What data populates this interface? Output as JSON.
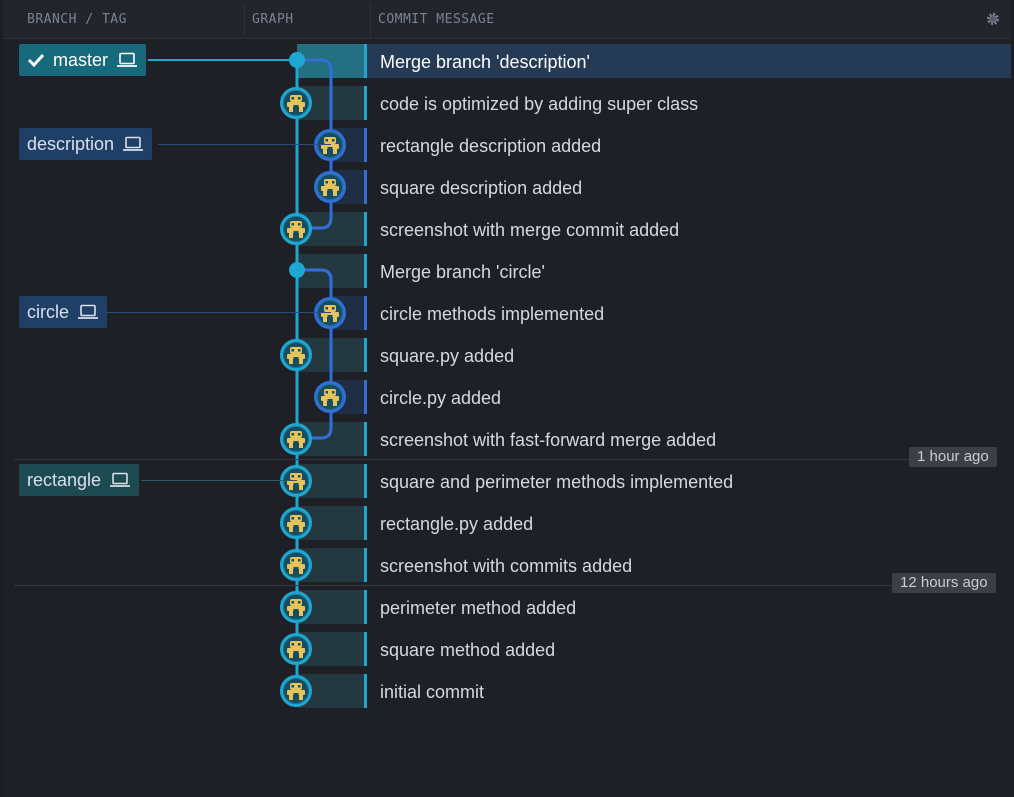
{
  "header": {
    "col_branch": "BRANCH / TAG",
    "col_graph": "GRAPH",
    "col_message": "COMMIT MESSAGE"
  },
  "branches": {
    "master": "master",
    "description": "description",
    "circle": "circle",
    "rectangle": "rectangle"
  },
  "commits": [
    {
      "message": "Merge branch 'description'",
      "lane": "merge",
      "selected": true
    },
    {
      "message": "code is optimized by adding super class",
      "lane": "teal"
    },
    {
      "message": "rectangle description added",
      "lane": "blue"
    },
    {
      "message": "square description added",
      "lane": "blue"
    },
    {
      "message": "screenshot with merge commit added",
      "lane": "teal"
    },
    {
      "message": "Merge branch 'circle'",
      "lane": "merge"
    },
    {
      "message": "circle methods implemented",
      "lane": "blue"
    },
    {
      "message": "square.py added",
      "lane": "teal"
    },
    {
      "message": "circle.py added",
      "lane": "blue"
    },
    {
      "message": "screenshot with fast-forward merge added",
      "lane": "teal"
    },
    {
      "message": "square and perimeter methods implemented",
      "lane": "teal"
    },
    {
      "message": "rectangle.py added",
      "lane": "teal"
    },
    {
      "message": "screenshot with commits added",
      "lane": "teal"
    },
    {
      "message": "perimeter method added",
      "lane": "teal"
    },
    {
      "message": "square method added",
      "lane": "teal"
    },
    {
      "message": "initial commit",
      "lane": "teal"
    }
  ],
  "time_markers": {
    "one_hour": "1 hour ago",
    "twelve_hours": "12 hours ago"
  },
  "colors": {
    "teal_lane": "#1ea7d0",
    "blue_lane": "#2f6fd8",
    "selected_row": "#243a55",
    "avatar_fill": "#e8c35a"
  },
  "icons": [
    "check-icon",
    "laptop-icon",
    "gear-icon",
    "commit-avatar-icon"
  ]
}
